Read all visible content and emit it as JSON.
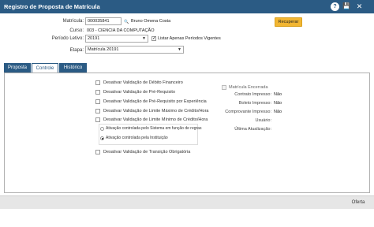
{
  "window": {
    "title": "Registro de Proposta de Matrícula",
    "help_glyph": "?",
    "save_glyph": "💾",
    "close_glyph": "✕"
  },
  "form": {
    "matricula_label": "Matrícula:",
    "matricula_value": "000035841",
    "student_name": "Bruno Omena Costa",
    "curso_label": "Curso:",
    "curso_value": "003 - CIENCIA DA COMPUTAÇÃO",
    "periodo_label": "Período Letivo:",
    "periodo_value": "20191",
    "listar_label": "Listar Apenas Períodos Vigentes",
    "listar_checked": true,
    "etapa_label": "Etapa:",
    "etapa_value": "Matrícula 20191",
    "recuperar_label": "Recuperar"
  },
  "tabs": [
    {
      "label": "Proposta",
      "active": false
    },
    {
      "label": "Controle",
      "active": true
    },
    {
      "label": "Histórico",
      "active": false
    }
  ],
  "controle": {
    "options": [
      "Desativar Validação de Débito Financeiro",
      "Desativar Validação de Pré-Requisito",
      "Desativar Validação de Pré-Requisito por Experiência",
      "Desativar Validação de Limite Máximo de Crédito/Hora",
      "Desativar Validação de Limite Mínimo de Crédito/Hora"
    ],
    "radios": [
      {
        "label": "Ativação controlada pelo Sistema em função de regras",
        "selected": false
      },
      {
        "label": "Ativação controlada pela Instituição",
        "selected": true
      }
    ],
    "transicao_label": "Desativar Validação de Transição Obrigatória",
    "matricula_encerrada_label": "Matrícula Encerrada",
    "status": [
      {
        "label": "Contrato Impresso:",
        "value": "Não"
      },
      {
        "label": "Boleto Impresso:",
        "value": "Não"
      },
      {
        "label": "Comprovante Impresso:",
        "value": "Não"
      },
      {
        "label": "Usuário:",
        "value": ""
      },
      {
        "label": "Última Atualização:",
        "value": ""
      }
    ]
  },
  "footer": {
    "oferta_label": "Oferta"
  }
}
